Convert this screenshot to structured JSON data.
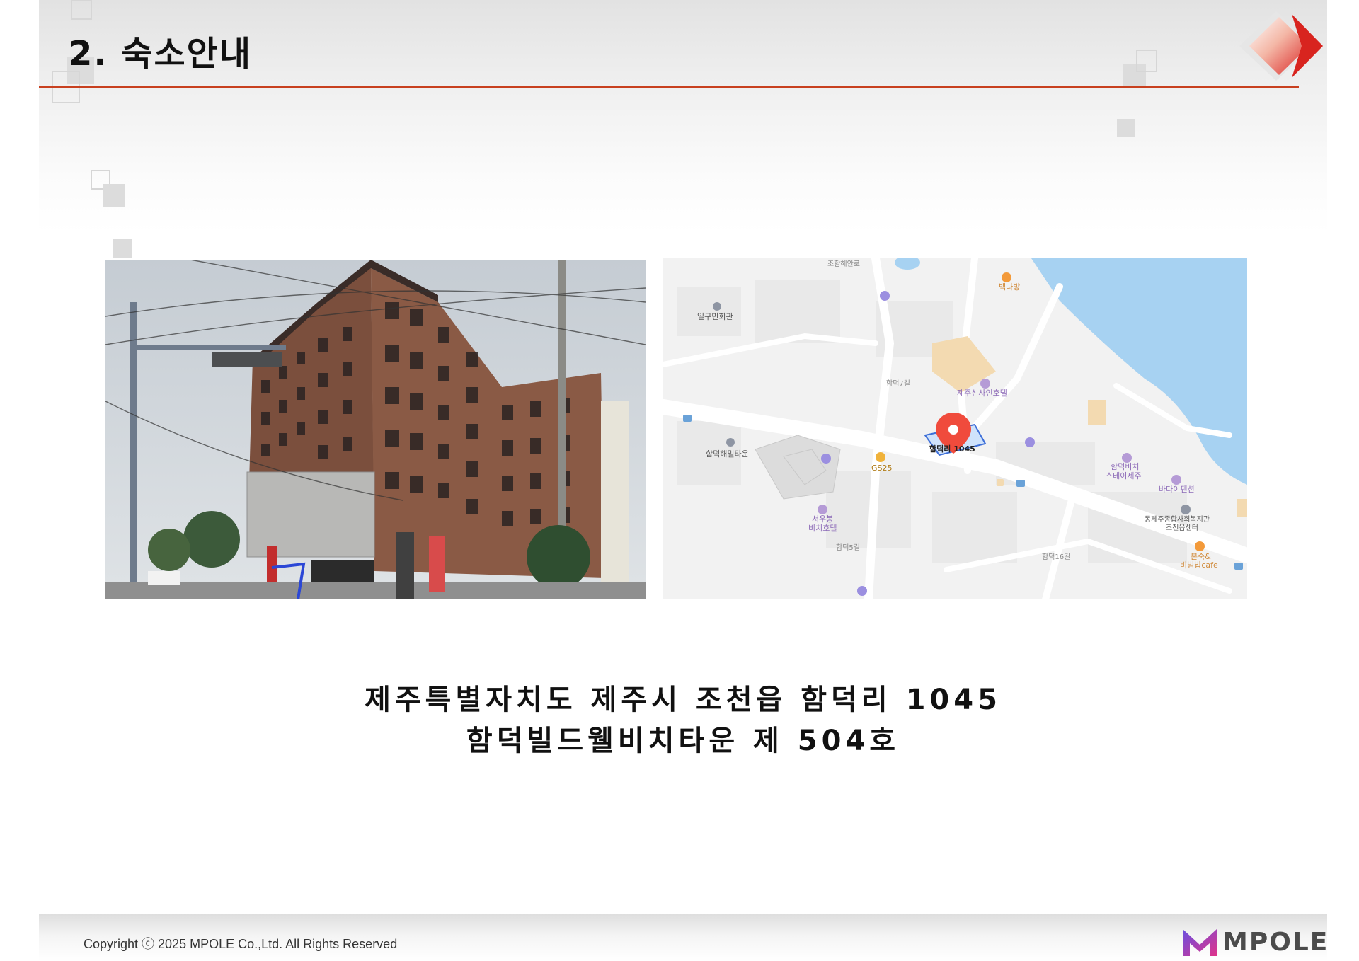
{
  "slide": {
    "title": "2. 숙소안내",
    "accent_color": "#c8401f"
  },
  "photo": {
    "subject": "building-exterior-photo"
  },
  "map": {
    "labels": {
      "iguminhoegwan": "일구민회관",
      "baekdabang": "백다방",
      "jejusunsain": "제주선사인호텔",
      "hamdeok7gil": "함덕7길",
      "hamdeokhaemil": "함덕해밀타운",
      "gs25": "GS25",
      "marker": "함덕리 1045",
      "hamdeokbeach_stay_1": "함덕비치",
      "hamdeokbeach_stay_2": "스테이제주",
      "badaipension": "바다이펜션",
      "welfare_1": "동제주종합사회복지관",
      "welfare_2": "조천읍센터",
      "seoubong_1": "서우봉",
      "seoubong_2": "비치호텔",
      "hamdeok16gil": "함덕16길",
      "cafe_1": "본죽&",
      "cafe_2": "비빔밥cafe",
      "hamdeok5gil": "함덕5길",
      "johamhaeanro": "조함해안로"
    },
    "colors": {
      "sea": "#a7d2f2",
      "marker": "#f04b3c",
      "poi": "#b59bd6",
      "food": "#f39a3a"
    }
  },
  "address": {
    "line1": "제주특별자치도 제주시 조천읍 함덕리 1045",
    "line2": "함덕빌드웰비치타운 제 504호"
  },
  "footer": {
    "copyright": "Copyright ⓒ 2025  MPOLE Co.,Ltd. All Rights Reserved",
    "brand": "MPOLE"
  }
}
